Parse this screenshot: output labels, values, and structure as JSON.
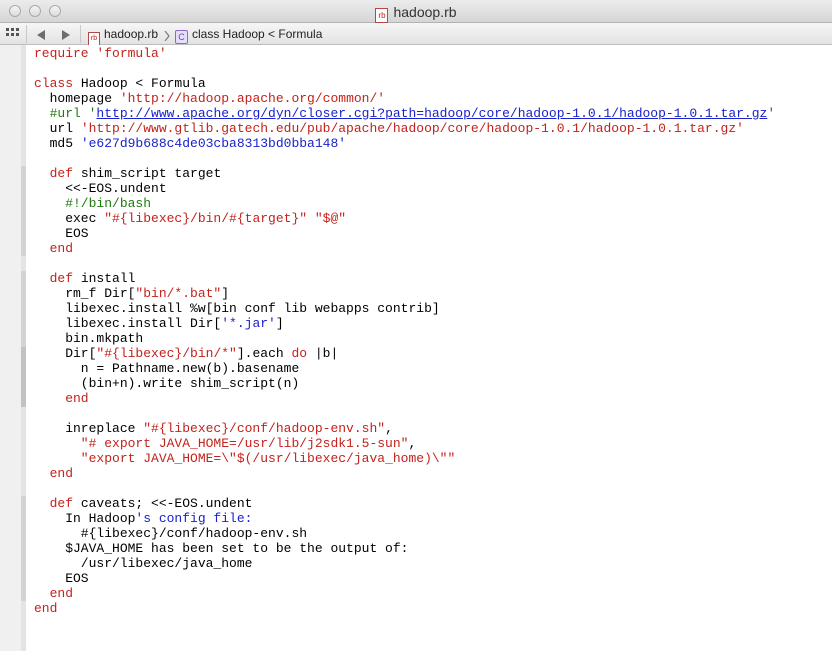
{
  "window": {
    "title": "hadoop.rb",
    "title_icon": "ruby-file-icon"
  },
  "jumpbar": {
    "file": "hadoop.rb",
    "symbol": "class Hadoop < Formula"
  },
  "code": {
    "lines": [
      [
        {
          "t": "require ",
          "c": "k"
        },
        {
          "t": "'formula'",
          "c": "s"
        }
      ],
      [],
      [
        {
          "t": "class",
          "c": "k"
        },
        {
          "t": " Hadoop < Formula"
        }
      ],
      [
        {
          "t": "  homepage "
        },
        {
          "t": "'http://hadoop.apache.org/common/'",
          "c": "s"
        }
      ],
      [
        {
          "t": "  #url '",
          "c": "c"
        },
        {
          "t": "http://www.apache.org/dyn/closer.cgi?path=hadoop/core/hadoop-1.0.1/hadoop-1.0.1.tar.gz",
          "c": "lk"
        },
        {
          "t": "'",
          "c": "c"
        }
      ],
      [
        {
          "t": "  url "
        },
        {
          "t": "'http://www.gtlib.gatech.edu/pub/apache/hadoop/core/hadoop-1.0.1/hadoop-1.0.1.tar.gz'",
          "c": "s"
        }
      ],
      [
        {
          "t": "  md5 "
        },
        {
          "t": "'e627d9b688c4de03cba8313bd0bba148'",
          "c": "b"
        }
      ],
      [],
      [
        {
          "t": "  def",
          "c": "k"
        },
        {
          "t": " shim_script target"
        }
      ],
      [
        {
          "t": "    <<-EOS.undent"
        }
      ],
      [
        {
          "t": "    #!/bin/bash",
          "c": "c"
        }
      ],
      [
        {
          "t": "    exec "
        },
        {
          "t": "\"#{libexec}/bin/#{target}\" \"$@\"",
          "c": "s"
        }
      ],
      [
        {
          "t": "    EOS"
        }
      ],
      [
        {
          "t": "  end",
          "c": "k"
        }
      ],
      [],
      [
        {
          "t": "  def",
          "c": "k"
        },
        {
          "t": " install"
        }
      ],
      [
        {
          "t": "    rm_f Dir["
        },
        {
          "t": "\"bin/*.bat\"",
          "c": "s"
        },
        {
          "t": "]"
        }
      ],
      [
        {
          "t": "    libexec.install %w[bin conf lib webapps contrib]"
        }
      ],
      [
        {
          "t": "    libexec.install Dir["
        },
        {
          "t": "'*.jar'",
          "c": "b"
        },
        {
          "t": "]"
        }
      ],
      [
        {
          "t": "    bin.mkpath"
        }
      ],
      [
        {
          "t": "    Dir["
        },
        {
          "t": "\"#{libexec}/bin/*\"",
          "c": "s"
        },
        {
          "t": "].each "
        },
        {
          "t": "do",
          "c": "k"
        },
        {
          "t": " |b|"
        }
      ],
      [
        {
          "t": "      n = Pathname.new(b).basename"
        }
      ],
      [
        {
          "t": "      (bin+n).write shim_script(n)"
        }
      ],
      [
        {
          "t": "    end",
          "c": "k"
        }
      ],
      [],
      [
        {
          "t": "    inreplace "
        },
        {
          "t": "\"#{libexec}/conf/hadoop-env.sh\"",
          "c": "s"
        },
        {
          "t": ","
        }
      ],
      [
        {
          "t": "      \"# export JAVA_HOME=/usr/lib/j2sdk1.5-sun\"",
          "c": "s"
        },
        {
          "t": ","
        }
      ],
      [
        {
          "t": "      \"export JAVA_HOME=\\\"$(/usr/libexec/java_home)\\\"\"",
          "c": "s"
        }
      ],
      [
        {
          "t": "  end",
          "c": "k"
        }
      ],
      [],
      [
        {
          "t": "  def",
          "c": "k"
        },
        {
          "t": " caveats; <<-EOS.undent"
        }
      ],
      [
        {
          "t": "    In Hadoop"
        },
        {
          "t": "'s config file:",
          "c": "b"
        }
      ],
      [
        {
          "t": "      #{libexec}/conf/hadoop-env.sh"
        }
      ],
      [
        {
          "t": "    $JAVA_HOME has been set to be the output of:"
        }
      ],
      [
        {
          "t": "      /usr/libexec/java_home"
        }
      ],
      [
        {
          "t": "    EOS"
        }
      ],
      [
        {
          "t": "  end",
          "c": "k"
        }
      ],
      [
        {
          "t": "end",
          "c": "k"
        }
      ]
    ]
  }
}
